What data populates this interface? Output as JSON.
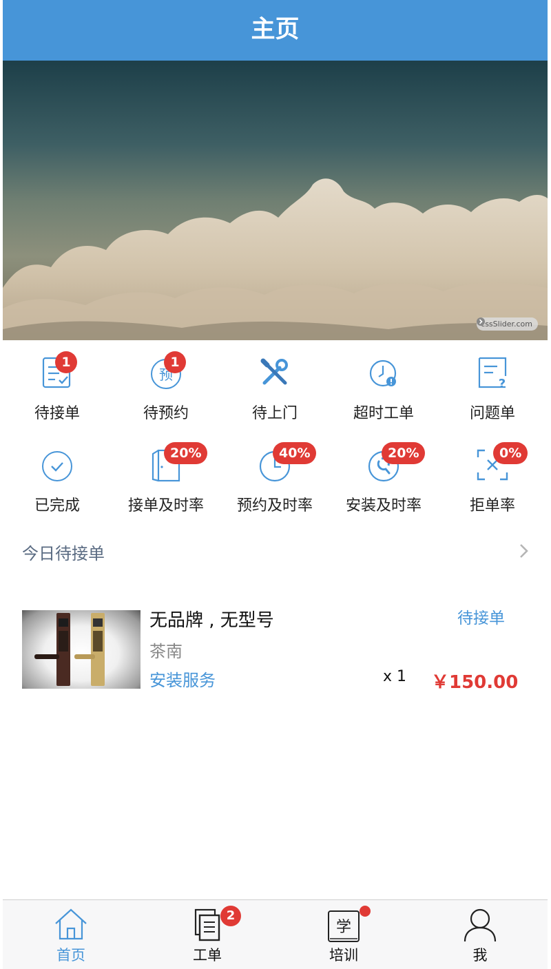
{
  "header": {
    "title": "主页"
  },
  "banner": {
    "credit": "cssSlider.com"
  },
  "grid": {
    "row1": [
      {
        "label": "待接单",
        "badge": "1",
        "icon": "clipboard-check-icon"
      },
      {
        "label": "待预约",
        "badge": "1",
        "icon": "reserve-circle-icon",
        "icon_text": "预"
      },
      {
        "label": "待上门",
        "badge": "",
        "icon": "tools-icon"
      },
      {
        "label": "超时工单",
        "badge": "",
        "icon": "clock-alert-icon"
      },
      {
        "label": "问题单",
        "badge": "",
        "icon": "question-doc-icon"
      }
    ],
    "row2": [
      {
        "label": "已完成",
        "badge": "",
        "icon": "check-circle-icon"
      },
      {
        "label": "接单及时率",
        "badge": "20%",
        "icon": "door-icon"
      },
      {
        "label": "预约及时率",
        "badge": "40%",
        "icon": "clock-circle-icon"
      },
      {
        "label": "安装及时率",
        "badge": "20%",
        "icon": "wrench-circle-icon"
      },
      {
        "label": "拒单率",
        "badge": "0%",
        "icon": "reject-box-icon"
      }
    ]
  },
  "section": {
    "title": "今日待接单"
  },
  "order": {
    "title": "无品牌 , 无型号",
    "subtitle": "茶南",
    "service": "安装服务",
    "status": "待接单",
    "quantity": "x 1",
    "price": "￥150.00"
  },
  "tabbar": {
    "items": [
      {
        "label": "首页",
        "icon": "home-icon",
        "active": true,
        "badge": ""
      },
      {
        "label": "工单",
        "icon": "documents-icon",
        "active": false,
        "badge": "2"
      },
      {
        "label": "培训",
        "icon": "study-book-icon",
        "active": false,
        "badge": "",
        "icon_text": "学"
      },
      {
        "label": "我",
        "icon": "user-icon",
        "active": false,
        "badge": ""
      }
    ]
  },
  "colors": {
    "primary": "#4795d8",
    "badge": "#e03a35",
    "price": "#e03a35"
  }
}
